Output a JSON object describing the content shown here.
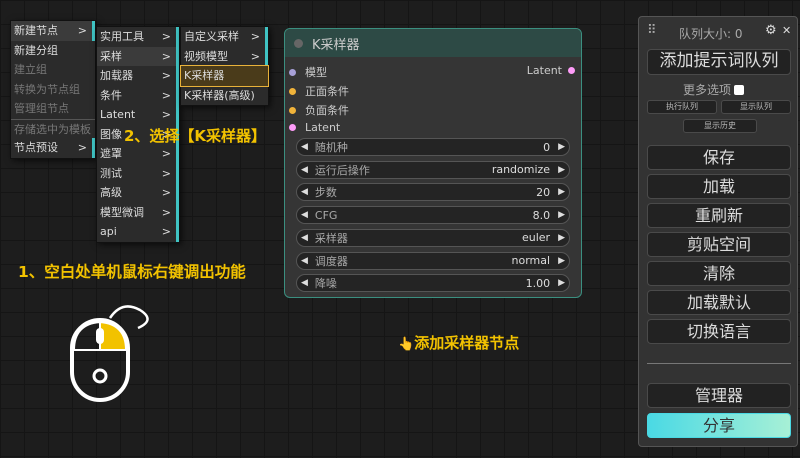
{
  "menu_main": [
    {
      "label": "新建节点",
      "arrow": ">",
      "state": "highlight"
    },
    {
      "label": "新建分组",
      "state": "normal"
    },
    {
      "label": "建立组",
      "state": "disabled"
    },
    {
      "label": "转换为节点组",
      "state": "disabled"
    },
    {
      "label": "管理组节点",
      "state": "disabled"
    },
    {
      "label": "存储选中为模板",
      "state": "disabled"
    },
    {
      "label": "节点预设",
      "arrow": ">",
      "state": "normal"
    }
  ],
  "menu_categories": [
    {
      "label": "实用工具",
      "arrow": ">"
    },
    {
      "label": "采样",
      "arrow": ">"
    },
    {
      "label": "加载器",
      "arrow": ">"
    },
    {
      "label": "条件",
      "arrow": ">"
    },
    {
      "label": "Latent",
      "arrow": ">"
    },
    {
      "label": "图像",
      "arrow": ">"
    },
    {
      "label": "遮罩",
      "arrow": ">"
    },
    {
      "label": "测试",
      "arrow": ">"
    },
    {
      "label": "高级",
      "arrow": ">"
    },
    {
      "label": "模型微调",
      "arrow": ">"
    },
    {
      "label": "api",
      "arrow": ">"
    }
  ],
  "menu_sampling": [
    {
      "label": "自定义采样",
      "arrow": ">"
    },
    {
      "label": "视频模型",
      "arrow": ">"
    },
    {
      "label": "K采样器"
    },
    {
      "label": "K采样器(高级)"
    }
  ],
  "node": {
    "title": "K采样器",
    "inputs": [
      {
        "label": "模型",
        "color": "#a7a0d8"
      },
      {
        "label": "正面条件",
        "color": "#f0b33a"
      },
      {
        "label": "负面条件",
        "color": "#f0b33a"
      },
      {
        "label": "Latent",
        "color": "#ff9cf9"
      }
    ],
    "output": {
      "label": "Latent",
      "color": "#ff9cf9"
    },
    "widgets": [
      {
        "label": "随机种",
        "value": "0"
      },
      {
        "label": "运行后操作",
        "value": "randomize"
      },
      {
        "label": "步数",
        "value": "20"
      },
      {
        "label": "CFG",
        "value": "8.0"
      },
      {
        "label": "采样器",
        "value": "euler"
      },
      {
        "label": "调度器",
        "value": "normal"
      },
      {
        "label": "降噪",
        "value": "1.00"
      }
    ]
  },
  "annotations": {
    "step2": "2、选择【K采样器】",
    "step1": "1、空白处单机鼠标右键调出功能",
    "add_node": "添加采样器节点",
    "hand": "👆"
  },
  "panel": {
    "grip": "⠿",
    "queue_size": "队列大小: 0",
    "gear": "⚙",
    "close": "✕",
    "queue_prompt": "添加提示词队列",
    "more_options": "更多选项",
    "view_queue": "执行队列",
    "view_queue2": "显示队列",
    "view_history": "显示历史",
    "buttons": [
      "保存",
      "加载",
      "重刷新",
      "剪贴空间",
      "清除",
      "加载默认",
      "切换语言"
    ],
    "manager": "管理器",
    "share": "分享"
  },
  "colors": {
    "accent": "#40c4c4",
    "annotation": "#f2c200",
    "node_border": "#3b8f80"
  }
}
